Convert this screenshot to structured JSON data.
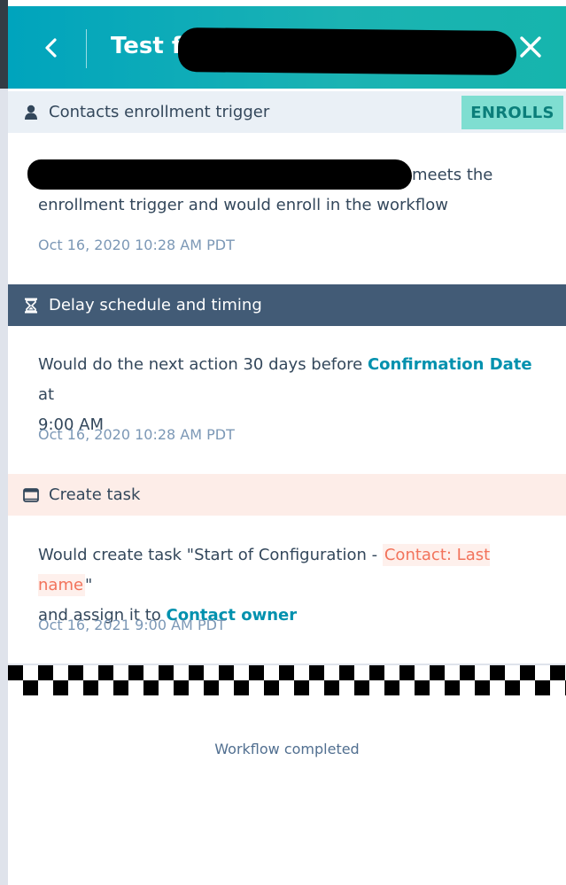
{
  "header": {
    "title": "Test fo",
    "back_icon": "chevron-left-icon",
    "close_icon": "close-icon"
  },
  "trigger_section": {
    "label": "Contacts enrollment trigger",
    "icon": "person-icon",
    "badge": "ENROLLS",
    "text_after_redaction": "meets the",
    "text_line2": "enrollment trigger and would enroll in the workflow",
    "timestamp": "Oct 16, 2020 10:28 AM PDT"
  },
  "delay_section": {
    "label": "Delay schedule and timing",
    "icon": "hourglass-icon",
    "text_prefix": "Would do the next action 30 days before",
    "property": "Confirmation Date",
    "text_mid": "at",
    "time": "9:00 AM",
    "timestamp": "Oct 16, 2020 10:28 AM PDT"
  },
  "task_section": {
    "label": "Create task",
    "icon": "task-icon",
    "text_prefix": "Would create task \"Start of Configuration -",
    "token": "Contact: Last name",
    "text_quote_close": "\"",
    "text_assign": "and assign it to",
    "assignee": "Contact owner",
    "timestamp": "Oct 16, 2021 9:00 AM PDT"
  },
  "footer": {
    "status": "Workflow completed"
  },
  "colors": {
    "header_gradient_start": "#00a4bd",
    "header_gradient_end": "#16b5ad",
    "trigger_bar": "#eaf0f6",
    "delay_bar": "#425b76",
    "task_bar": "#fdede8",
    "badge_bg": "#7fded1",
    "accent": "#0091ae",
    "token": "#f2735b"
  }
}
